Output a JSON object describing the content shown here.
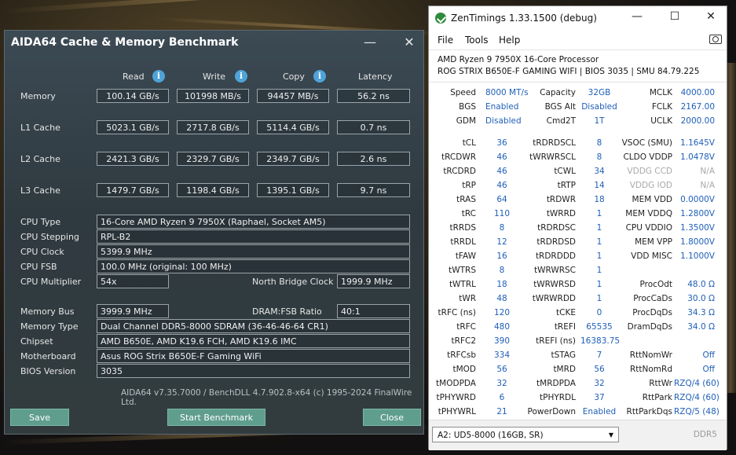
{
  "aida": {
    "title": "AIDA64 Cache & Memory Benchmark",
    "close_glyph": "✕",
    "minimize_glyph": "—",
    "columns": [
      "Read",
      "Write",
      "Copy",
      "Latency"
    ],
    "rows": [
      {
        "label": "Memory",
        "read": "100.14 GB/s",
        "write": "101998 MB/s",
        "copy": "94457 MB/s",
        "latency": "56.2 ns"
      },
      {
        "label": "L1 Cache",
        "read": "5023.1 GB/s",
        "write": "2717.8 GB/s",
        "copy": "5114.4 GB/s",
        "latency": "0.7 ns"
      },
      {
        "label": "L2 Cache",
        "read": "2421.3 GB/s",
        "write": "2329.7 GB/s",
        "copy": "2349.7 GB/s",
        "latency": "2.6 ns"
      },
      {
        "label": "L3 Cache",
        "read": "1479.7 GB/s",
        "write": "1198.4 GB/s",
        "copy": "1395.1 GB/s",
        "latency": "9.7 ns"
      }
    ],
    "cpu_type_label": "CPU Type",
    "cpu_type": "16-Core AMD Ryzen 9 7950X  (Raphael, Socket AM5)",
    "cpu_stepping_label": "CPU Stepping",
    "cpu_stepping": "RPL-B2",
    "cpu_clock_label": "CPU Clock",
    "cpu_clock": "5399.9 MHz",
    "cpu_fsb_label": "CPU FSB",
    "cpu_fsb": "100.0 MHz  (original: 100 MHz)",
    "cpu_multiplier_label": "CPU Multiplier",
    "cpu_multiplier": "54x",
    "nb_clock_label": "North Bridge Clock",
    "nb_clock": "1999.9 MHz",
    "memory_bus_label": "Memory Bus",
    "memory_bus": "3999.9 MHz",
    "dram_fsb_label": "DRAM:FSB Ratio",
    "dram_fsb": "40:1",
    "memory_type_label": "Memory Type",
    "memory_type": "Dual Channel DDR5-8000 SDRAM  (36-46-46-64 CR1)",
    "chipset_label": "Chipset",
    "chipset": "AMD B650E, AMD K19.6 FCH, AMD K19.6 IMC",
    "motherboard_label": "Motherboard",
    "motherboard": "Asus ROG Strix B650E-F Gaming WiFi",
    "bios_label": "BIOS Version",
    "bios": "3035",
    "footer": "AIDA64 v7.35.7000 / BenchDLL 4.7.902.8-x64  (c) 1995-2024 FinalWire Ltd.",
    "save_label": "Save",
    "start_label": "Start Benchmark",
    "close_label": "Close"
  },
  "zen": {
    "title": "ZenTimings 1.33.1500 (debug)",
    "menu": [
      "File",
      "Tools",
      "Help"
    ],
    "cpu": "AMD Ryzen 9 7950X 16-Core Processor",
    "board": "ROG STRIX B650E-F GAMING WIFI | BIOS 3035 | SMU 84.79.225",
    "top": [
      [
        [
          "Speed",
          "8000 MT/s"
        ],
        [
          "Capacity",
          "32GB"
        ],
        [
          "MCLK",
          "4000.00"
        ]
      ],
      [
        [
          "BGS",
          "Enabled"
        ],
        [
          "BGS Alt",
          "Disabled"
        ],
        [
          "FCLK",
          "2167.00"
        ]
      ],
      [
        [
          "GDM",
          "Disabled"
        ],
        [
          "Cmd2T",
          "1T"
        ],
        [
          "UCLK",
          "2000.00"
        ]
      ]
    ],
    "timings": [
      [
        [
          "tCL",
          "36"
        ],
        [
          "tRDRDSCL",
          "8"
        ],
        [
          "VSOC (SMU)",
          "1.1645V"
        ]
      ],
      [
        [
          "tRCDWR",
          "46"
        ],
        [
          "tWRWRSCL",
          "8"
        ],
        [
          "CLDO VDDP",
          "1.0478V"
        ]
      ],
      [
        [
          "tRCDRD",
          "46"
        ],
        [
          "tCWL",
          "34"
        ],
        [
          "VDDG CCD",
          "N/A"
        ]
      ],
      [
        [
          "tRP",
          "46"
        ],
        [
          "tRTP",
          "14"
        ],
        [
          "VDDG IOD",
          "N/A"
        ]
      ],
      [
        [
          "tRAS",
          "64"
        ],
        [
          "tRDWR",
          "18"
        ],
        [
          "MEM VDD",
          "0.0000V"
        ]
      ],
      [
        [
          "tRC",
          "110"
        ],
        [
          "tWRRD",
          "1"
        ],
        [
          "MEM VDDQ",
          "1.2800V"
        ]
      ],
      [
        [
          "tRRDS",
          "8"
        ],
        [
          "tRDRDSC",
          "1"
        ],
        [
          "CPU VDDIO",
          "1.3500V"
        ]
      ],
      [
        [
          "tRRDL",
          "12"
        ],
        [
          "tRDRDSD",
          "1"
        ],
        [
          "MEM VPP",
          "1.8000V"
        ]
      ],
      [
        [
          "tFAW",
          "16"
        ],
        [
          "tRDRDDD",
          "1"
        ],
        [
          "VDD MISC",
          "1.1000V"
        ]
      ],
      [
        [
          "tWTRS",
          "8"
        ],
        [
          "tWRWRSC",
          "1"
        ],
        [
          "",
          ""
        ]
      ],
      [
        [
          "tWTRL",
          "18"
        ],
        [
          "tWRWRSD",
          "1"
        ],
        [
          "ProcOdt",
          "48.0 Ω"
        ]
      ],
      [
        [
          "tWR",
          "48"
        ],
        [
          "tWRWRDD",
          "1"
        ],
        [
          "ProcCaDs",
          "30.0 Ω"
        ]
      ],
      [
        [
          "tRFC (ns)",
          "120"
        ],
        [
          "tCKE",
          "0"
        ],
        [
          "ProcDqDs",
          "34.3 Ω"
        ]
      ],
      [
        [
          "tRFC",
          "480"
        ],
        [
          "tREFI",
          "65535"
        ],
        [
          "DramDqDs",
          "34.0 Ω"
        ]
      ],
      [
        [
          "tRFC2",
          "390"
        ],
        [
          "tREFI (ns)",
          "16383.75"
        ],
        [
          "",
          ""
        ]
      ],
      [
        [
          "tRFCsb",
          "334"
        ],
        [
          "tSTAG",
          "7"
        ],
        [
          "RttNomWr",
          "Off"
        ]
      ],
      [
        [
          "tMOD",
          "56"
        ],
        [
          "tMRD",
          "56"
        ],
        [
          "RttNomRd",
          "Off"
        ]
      ],
      [
        [
          "tMODPDA",
          "32"
        ],
        [
          "tMRDPDA",
          "32"
        ],
        [
          "RttWr",
          "RZQ/4 (60)"
        ]
      ],
      [
        [
          "tPHYWRD",
          "6"
        ],
        [
          "tPHYRDL",
          "37"
        ],
        [
          "RttPark",
          "RZQ/4 (60)"
        ]
      ],
      [
        [
          "tPHYWRL",
          "21"
        ],
        [
          "PowerDown",
          "Enabled"
        ],
        [
          "RttParkDqs",
          "RZQ/5 (48)"
        ]
      ]
    ],
    "dim_labels": [
      "VDDG CCD",
      "VDDG IOD"
    ],
    "module": "A2: UD5-8000 (16GB, SR)",
    "ddr": "DDR5"
  }
}
